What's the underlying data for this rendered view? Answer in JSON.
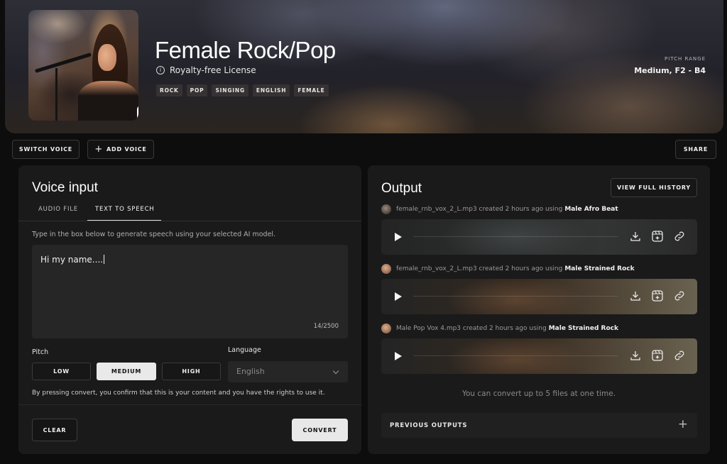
{
  "hero": {
    "title": "Female Rock/Pop",
    "license": "Royalty-free License",
    "tags": [
      "ROCK",
      "POP",
      "SINGING",
      "ENGLISH",
      "FEMALE"
    ],
    "pitch_range_label": "PITCH RANGE",
    "pitch_range_value": "Medium, F2 - B4",
    "add_symbol": "+"
  },
  "actions": {
    "switch_voice": "SWITCH VOICE",
    "add_voice": "ADD VOICE",
    "add_voice_symbol": "+",
    "share": "SHARE"
  },
  "voice_input": {
    "title": "Voice input",
    "tabs": [
      "AUDIO FILE",
      "TEXT TO SPEECH"
    ],
    "active_tab": "TEXT TO SPEECH",
    "helper": "Type in the box below to generate speech using your selected AI model.",
    "text_value": "Hi my name....",
    "char_count": "14/2500",
    "pitch_label": "Pitch",
    "pitch_options": [
      "LOW",
      "MEDIUM",
      "HIGH"
    ],
    "pitch_selected": "MEDIUM",
    "language_label": "Language",
    "language_value": "English",
    "disclaimer": "By pressing convert, you confirm that this is your content and you have the rights to use it.",
    "clear": "CLEAR",
    "convert": "CONVERT"
  },
  "output": {
    "title": "Output",
    "history_button": "VIEW FULL HISTORY",
    "items": [
      {
        "file": "female_rnb_vox_2_L.mp3 created 2 hours ago using",
        "model": "Male Afro Beat"
      },
      {
        "file": "female_rnb_vox_2_L.mp3 created 2 hours ago using",
        "model": "Male Strained Rock"
      },
      {
        "file": "Male Pop Vox 4.mp3 created 2 hours ago using",
        "model": "Male Strained Rock"
      }
    ],
    "limit_note": "You can convert up to 5 files at one time.",
    "previous_outputs": "PREVIOUS OUTPUTS",
    "previous_symbol": "+"
  },
  "icons": [
    "info-icon",
    "plus-icon",
    "play-icon",
    "download-icon",
    "sparkle-icon",
    "link-icon",
    "chevron-down-icon"
  ],
  "colors": {
    "background": "#0d0d0d",
    "panel": "#1a1a1a",
    "accent": "#e8e8e8"
  }
}
